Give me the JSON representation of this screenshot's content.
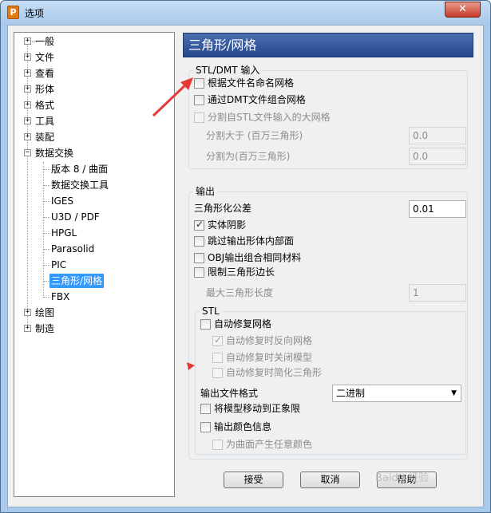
{
  "window": {
    "title": "选项",
    "app_icon_letter": "P",
    "close_glyph": "✕"
  },
  "tree": {
    "items": [
      {
        "label": "一般",
        "expander": "+"
      },
      {
        "label": "文件",
        "expander": "+"
      },
      {
        "label": "查看",
        "expander": "+"
      },
      {
        "label": "形体",
        "expander": "+"
      },
      {
        "label": "格式",
        "expander": "+"
      },
      {
        "label": "工具",
        "expander": "+"
      },
      {
        "label": "装配",
        "expander": "+"
      },
      {
        "label": "数据交换",
        "expander": "−"
      },
      {
        "label": "版本 8 / 曲面",
        "child": true
      },
      {
        "label": "数据交换工具",
        "child": true
      },
      {
        "label": "IGES",
        "child": true
      },
      {
        "label": "U3D / PDF",
        "child": true
      },
      {
        "label": "HPGL",
        "child": true
      },
      {
        "label": "Parasolid",
        "child": true
      },
      {
        "label": "PIC",
        "child": true
      },
      {
        "label": "三角形/网格",
        "child": true,
        "selected": true
      },
      {
        "label": "FBX",
        "child": true
      },
      {
        "label": "绘图",
        "expander": "+"
      },
      {
        "label": "制造",
        "expander": "+"
      }
    ]
  },
  "panel": {
    "header": "三角形/网格",
    "stl_dmt": {
      "title": "STL/DMT 输入",
      "name_by_file": {
        "label": "根据文件名命名网格",
        "checked": false
      },
      "combine_by_dmt": {
        "label": "通过DMT文件组合网格",
        "checked": false
      },
      "split_large": {
        "label": "分割自STL文件输入的大网格",
        "checked": false
      },
      "split_above": {
        "label": "分割大于 (百万三角形)",
        "value": "0.0"
      },
      "split_to": {
        "label": "分割为(百万三角形)",
        "value": "0.0"
      }
    },
    "output": {
      "title": "输出",
      "tolerance": {
        "label": "三角形化公差",
        "value": "0.01"
      },
      "solid_shading": {
        "label": "实体阴影",
        "checked": true
      },
      "skip_internal": {
        "label": "跳过输出形体内部面",
        "checked": false
      },
      "obj_combine": {
        "label": "OBJ输出组合相同材料",
        "checked": false
      },
      "limit_edge": {
        "label": "限制三角形边长",
        "checked": false
      },
      "max_edge": {
        "label": "最大三角形长度",
        "value": "1"
      },
      "stl": {
        "title": "STL",
        "auto_repair": {
          "label": "自动修复网格",
          "checked": false
        },
        "repair_reverse": {
          "label": "自动修复时反向网格",
          "checked": true
        },
        "repair_close": {
          "label": "自动修复时关闭模型",
          "checked": false
        },
        "repair_simplify": {
          "label": "自动修复时简化三角形",
          "checked": false
        },
        "format": {
          "label": "输出文件格式",
          "value": "二进制"
        },
        "move_positive": {
          "label": "将模型移动到正象限",
          "checked": false
        },
        "output_color": {
          "label": "输出颜色信息",
          "checked": false
        },
        "random_color": {
          "label": "为曲面产生任意颜色",
          "checked": false
        }
      }
    }
  },
  "buttons": {
    "accept": "接受",
    "cancel": "取消",
    "help": "帮助"
  },
  "watermark": "Baidu 经验",
  "colors": {
    "header_bg": "#24478c",
    "selection": "#3399ff",
    "annotation_arrow": "#e53935"
  }
}
